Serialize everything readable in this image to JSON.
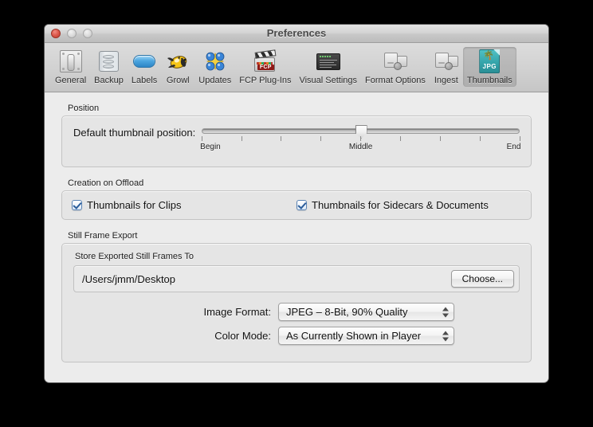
{
  "window": {
    "title": "Preferences",
    "traffic_lights": [
      {
        "name": "close",
        "label": "Close"
      },
      {
        "name": "minimize",
        "label": "Minimize"
      },
      {
        "name": "zoom",
        "label": "Zoom"
      }
    ]
  },
  "toolbar": {
    "items": [
      {
        "label": "General",
        "icon": "toggle-switch-icon",
        "selected": false
      },
      {
        "label": "Backup",
        "icon": "hard-drive-icon",
        "selected": false
      },
      {
        "label": "Labels",
        "icon": "blue-pill-icon",
        "selected": false
      },
      {
        "label": "Growl",
        "icon": "growl-bee-icon",
        "selected": false
      },
      {
        "label": "Updates",
        "icon": "updates-star-icon",
        "selected": false
      },
      {
        "label": "FCP Plug-Ins",
        "icon": "clapperboard-icon",
        "selected": false
      },
      {
        "label": "Visual Settings",
        "icon": "settings-panel-icon",
        "selected": false
      },
      {
        "label": "Format Options",
        "icon": "format-cards-icon",
        "selected": false
      },
      {
        "label": "Ingest",
        "icon": "ingest-cards-icon",
        "selected": false
      },
      {
        "label": "Thumbnails",
        "icon": "jpg-document-icon",
        "selected": true
      }
    ]
  },
  "position_group": {
    "title": "Position",
    "slider_label": "Default thumbnail position:",
    "slider": {
      "value": 50,
      "min": 0,
      "max": 100,
      "tick_count": 9,
      "tick_labels": [
        {
          "text": "Begin",
          "position": 0
        },
        {
          "text": "Middle",
          "position": 50
        },
        {
          "text": "End",
          "position": 100
        }
      ]
    }
  },
  "creation_group": {
    "title": "Creation on Offload",
    "checkboxes": [
      {
        "label": "Thumbnails for Clips",
        "checked": true
      },
      {
        "label": "Thumbnails for Sidecars & Documents",
        "checked": true
      }
    ]
  },
  "still_frame_group": {
    "title": "Still Frame Export",
    "store_label": "Store Exported Still Frames To",
    "path_value": "/Users/jmm/Desktop",
    "choose_button": "Choose...",
    "fields": [
      {
        "label": "Image Format:",
        "value": "JPEG – 8-Bit, 90% Quality"
      },
      {
        "label": "Color Mode:",
        "value": "As Currently Shown in Player"
      }
    ]
  },
  "colors": {
    "window_bg": "#ececec",
    "group_bg": "#e5e5e5",
    "desktop_bg": "#000000",
    "checkbox_accent": "#2b5d9b",
    "thumbnail_icon": "#35a5ab"
  }
}
